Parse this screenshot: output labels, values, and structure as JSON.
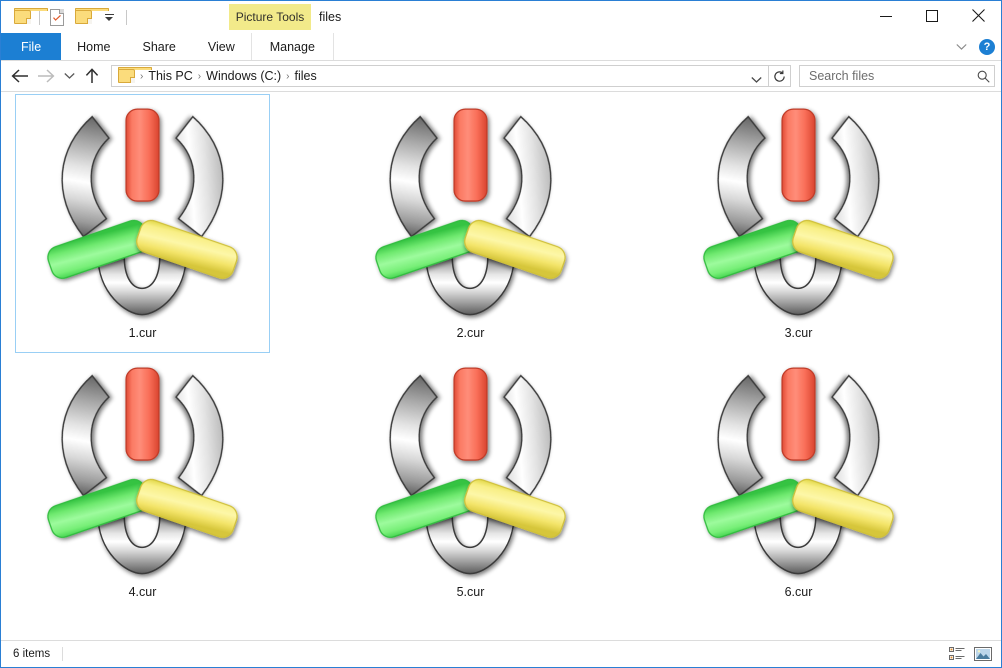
{
  "window": {
    "title": "files",
    "context_tab": "Picture Tools",
    "minimize_label": "Minimize",
    "maximize_label": "Maximize",
    "close_label": "Close"
  },
  "quick_access": {
    "items": [
      {
        "name": "folder-icon",
        "label": "Folder"
      },
      {
        "name": "properties-icon",
        "label": "Properties"
      },
      {
        "name": "new-folder-icon",
        "label": "New folder"
      },
      {
        "name": "customize-dropdown-icon",
        "label": "Customize Quick Access Toolbar"
      }
    ]
  },
  "ribbon": {
    "tabs": [
      {
        "id": "file",
        "label": "File"
      },
      {
        "id": "home",
        "label": "Home"
      },
      {
        "id": "share",
        "label": "Share"
      },
      {
        "id": "view",
        "label": "View"
      },
      {
        "id": "manage",
        "label": "Manage"
      }
    ],
    "expand_label": "Expand the Ribbon",
    "help_label": "?"
  },
  "navigation": {
    "back_label": "Back",
    "forward_label": "Forward",
    "recent_label": "Recent locations",
    "up_label": "Up",
    "refresh_label": "Refresh",
    "breadcrumb": [
      "This PC",
      "Windows (C:)",
      "files"
    ],
    "breadcrumb_separator": "›"
  },
  "search": {
    "placeholder": "Search files",
    "value": "",
    "icon": "search-icon"
  },
  "files": [
    {
      "name": "1.cur",
      "selected": true
    },
    {
      "name": "2.cur",
      "selected": false
    },
    {
      "name": "3.cur",
      "selected": false
    },
    {
      "name": "4.cur",
      "selected": false
    },
    {
      "name": "5.cur",
      "selected": false
    },
    {
      "name": "6.cur",
      "selected": false
    }
  ],
  "status": {
    "items_text": "6 items",
    "details_view_label": "Details view",
    "large_icons_view_label": "Large icons view"
  },
  "colors": {
    "accent": "#1c7fd3",
    "window_border": "#2a7fd4",
    "context_tab": "#f2ea8a",
    "selection_border": "#99cff5",
    "pipe_red": "#f96e58",
    "pipe_green": "#7cf07c",
    "pipe_yellow": "#f7e96b",
    "pipe_gray_light": "#fdfdfd",
    "pipe_gray_dark": "#6e6e6e"
  }
}
